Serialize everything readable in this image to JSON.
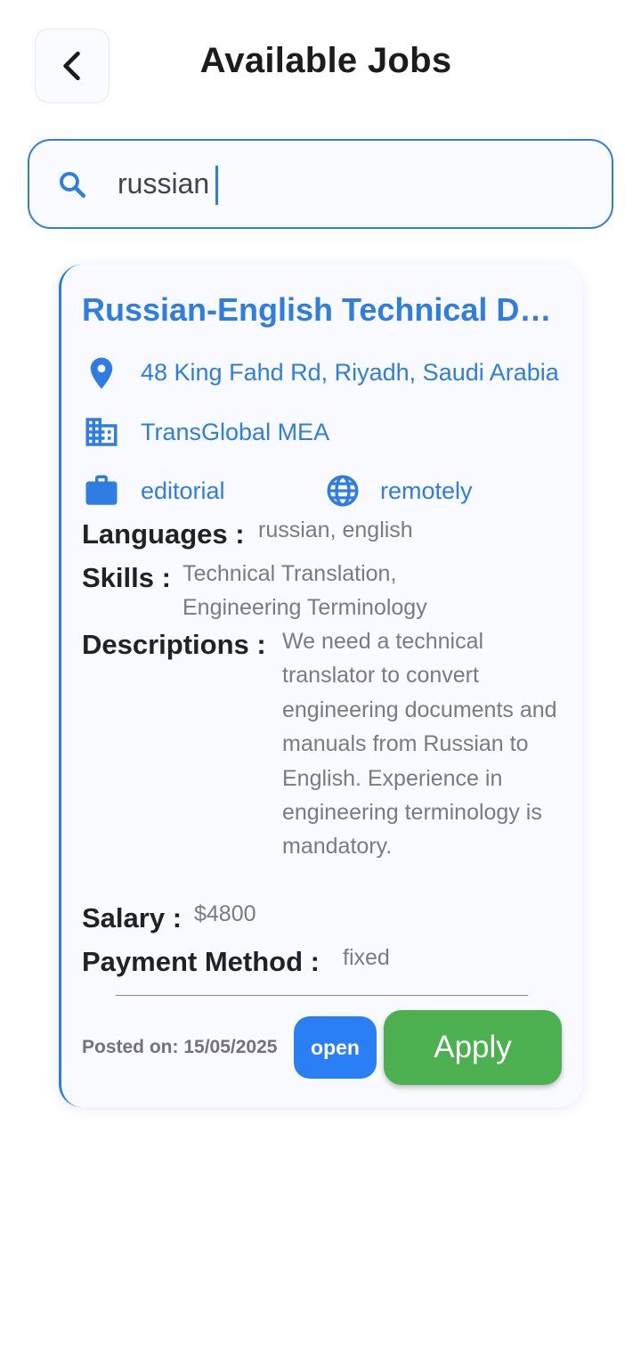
{
  "header": {
    "title": "Available Jobs",
    "back_icon": "chevron-left-icon"
  },
  "search": {
    "value": "russian",
    "placeholder": "",
    "icon": "search-icon"
  },
  "job": {
    "title": "Russian-English Technical Documentation Translator",
    "location": "48 King Fahd Rd, Riyadh, Saudi Arabia",
    "company": "TransGlobal MEA",
    "category": "editorial",
    "work_mode": "remotely",
    "languages_label": "Languages :",
    "languages": "russian, english",
    "skills_label": "Skills :",
    "skills": "Technical Translation, Engineering Terminology",
    "descriptions_label": "Descriptions :",
    "descriptions": "We need a technical translator to convert engineering documents and manuals from Russian to English. Experience in engineering terminology is mandatory.",
    "salary_label": "Salary :",
    "salary": "$4800",
    "payment_label": "Payment Method :",
    "payment": "fixed",
    "posted": "Posted on: 15/05/2025",
    "status": "open",
    "apply_label": "Apply"
  },
  "colors": {
    "accent": "#2f7de1",
    "status_badge": "#2b7ff5",
    "apply": "#4caf50",
    "card_bg": "#f9faff"
  }
}
